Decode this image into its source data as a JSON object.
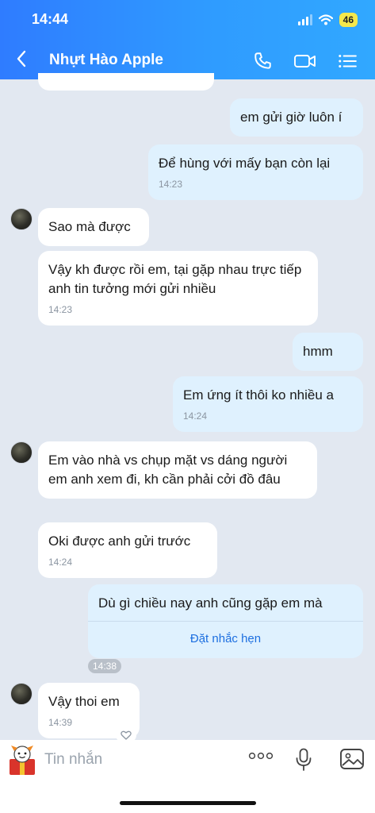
{
  "status_bar": {
    "time": "14:44",
    "battery": "46"
  },
  "header": {
    "title": "Nhựt Hào Apple"
  },
  "messages": [
    {
      "text": "em gửi giờ luôn í"
    },
    {
      "text": "Để hùng với mấy bạn còn lại",
      "time": "14:23"
    },
    {
      "text": "Sao mà được"
    },
    {
      "text": "Vậy kh được rồi em, tại gặp nhau trực tiếp anh tin tưởng mới gửi nhiều",
      "time": "14:23"
    },
    {
      "text": "hmm"
    },
    {
      "text": "Em ứng ít thôi ko nhiều a",
      "time": "14:24"
    },
    {
      "text": "Em vào nhà vs chụp mặt vs dáng người em anh xem đi, kh cần phải cởi đồ đâu"
    },
    {
      "text": "Oki được anh gửi trước",
      "time": "14:24"
    },
    {
      "text": "Dù gì chiều nay anh cũng gặp em mà",
      "action": "Đặt nhắc hẹn",
      "time": "14:38"
    },
    {
      "text": "Vậy thoi em",
      "time": "14:39"
    }
  ],
  "composer": {
    "placeholder": "Tin nhắn"
  },
  "colors": {
    "header_start": "#2f7cff",
    "header_end": "#31a8ff",
    "outgoing_bubble": "#dff1fe",
    "incoming_bubble": "#ffffff",
    "chat_background": "#e2e8f1",
    "link": "#1d6fe0"
  },
  "icons": [
    "back-chevron-icon",
    "phone-icon",
    "video-call-icon",
    "menu-list-icon",
    "sticker-icon",
    "more-icon",
    "microphone-icon",
    "image-icon",
    "heart-icon"
  ]
}
